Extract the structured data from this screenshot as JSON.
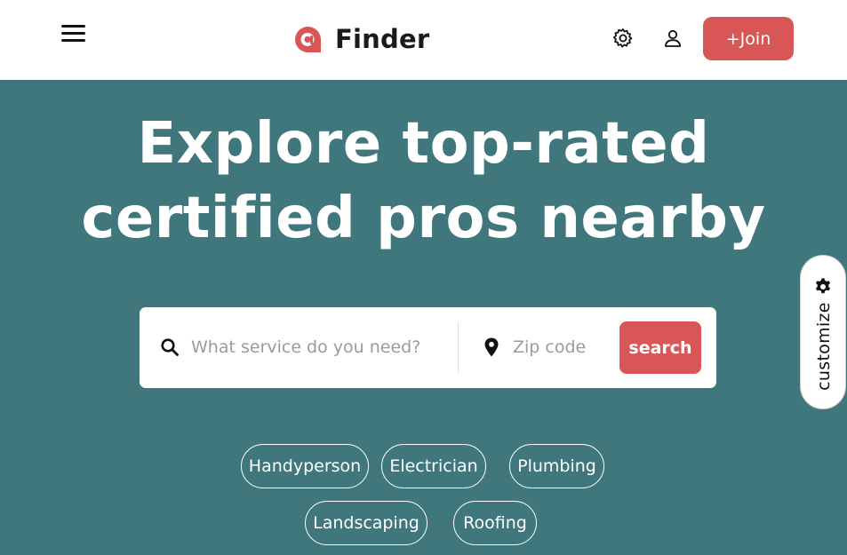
{
  "header": {
    "brand_name": "Finder",
    "logo_icon": "finder-logo-icon",
    "menu_icon": "hamburger-menu-icon",
    "settings_icon": "gear-icon",
    "account_icon": "user-icon",
    "join_label": "+Join"
  },
  "hero": {
    "title_line1": "Explore top-rated",
    "title_line2": "certified pros nearby",
    "search": {
      "service_placeholder": "What service do you need?",
      "service_value": "",
      "zip_placeholder": "Zip code",
      "zip_value": "",
      "button_label": "search",
      "search_icon": "search-icon",
      "location_icon": "map-pin-icon"
    },
    "tags": [
      "Handyperson",
      "Electrician",
      "Plumbing",
      "Landscaping",
      "Roofing"
    ]
  },
  "customize": {
    "label": "customize",
    "icon": "gear-icon"
  },
  "colors": {
    "accent": "#d95656",
    "hero_background": "#3f777c",
    "header_background": "#ffffff",
    "text_dark": "#1a1a1a"
  }
}
